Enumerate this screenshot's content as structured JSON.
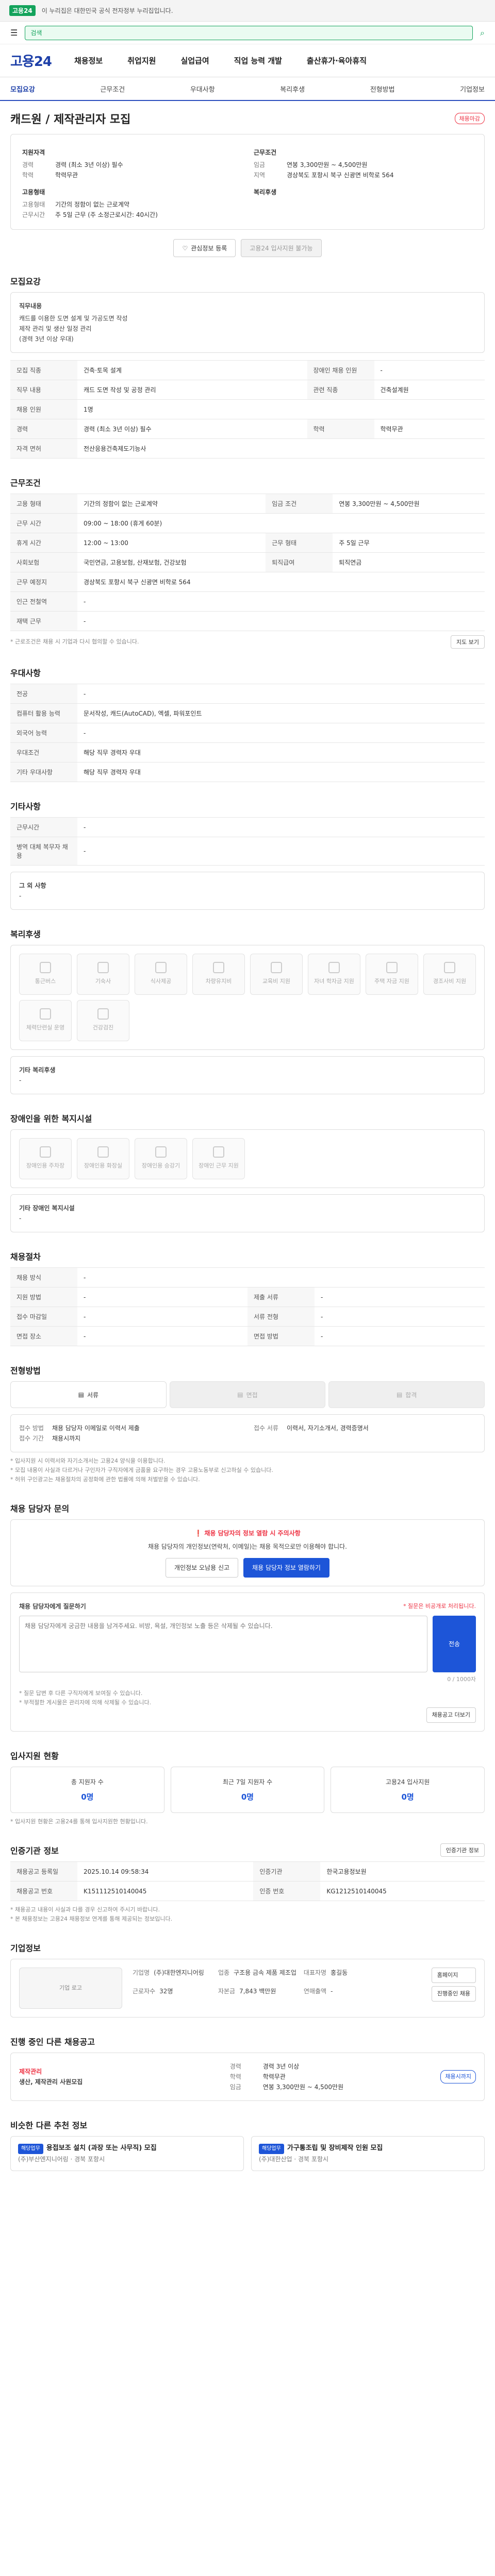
{
  "topbar": {
    "notice": "이 누리집은 대한민국 공식 전자정부 누리집입니다.",
    "logo": "고용24"
  },
  "subbar": {
    "search_placeholder": "검색",
    "search_button": "검색"
  },
  "header": {
    "brand": "고용24",
    "nav": [
      "채용정보",
      "취업지원",
      "실업급여",
      "직업 능력 개발",
      "출산휴가·육아휴직"
    ]
  },
  "tabs": [
    "모집요강",
    "근무조건",
    "우대사항",
    "복리후생",
    "전형방법",
    "기업정보"
  ],
  "job": {
    "title": "캐드원 / 제작관리자 모집",
    "badge": "채용마감",
    "left_head": "지원자격",
    "left_rows": [
      {
        "k": "경력",
        "v": "경력 (최소 3년 이상) 필수"
      },
      {
        "k": "학력",
        "v": "학력무관"
      }
    ],
    "left_head2": "고용형태",
    "left_rows2": [
      {
        "k": "고용형태",
        "v": "기간의 정함이 없는 근로계약"
      },
      {
        "k": "근무시간",
        "v": "주 5일 근무 (주 소정근로시간: 40시간)"
      }
    ],
    "right_head": "근무조건",
    "right_rows": [
      {
        "k": "임금",
        "v": "연봉 3,300만원 ~ 4,500만원"
      },
      {
        "k": "지역",
        "v": "경상북도 포항시 북구 신광면 비학로 564"
      }
    ],
    "right_head2": "복리후생",
    "btn_save": "관심정보 등록",
    "btn_apply": "고용24 입사지원 불가능"
  },
  "recruit": {
    "title": "모집요강",
    "summary_head": "직무내용",
    "summary_lines": [
      "캐드를 이용한 도면 설계 및 가공도면 작성",
      "제작 관리 및 생산 일정 관리",
      "(경력 3년 이상 우대)"
    ],
    "rows": [
      {
        "k": "모집 직종",
        "v": "건축·토목 설계",
        "k2": "장애인 채용 인원",
        "v2": "-"
      },
      {
        "k": "직무 내용",
        "v": "캐드 도면 작성 및 공정 관리",
        "k2": "관련 직종",
        "v2": "건축설계원"
      },
      {
        "k": "채용 인원",
        "v": "1명",
        "k2": "",
        "v2": ""
      },
      {
        "k": "경력",
        "v": "경력 (최소 3년 이상) 필수",
        "k2": "학력",
        "v2": "학력무관"
      },
      {
        "k": "자격 면허",
        "v": "전산응용건축제도기능사",
        "k2": "",
        "v2": ""
      }
    ]
  },
  "condition": {
    "title": "근무조건",
    "rows": [
      {
        "k": "고용 형태",
        "v": "기간의 정함이 없는 근로계약",
        "k2": "임금 조건",
        "v2": "연봉 3,300만원 ~ 4,500만원"
      },
      {
        "k": "근무 시간",
        "v": "09:00 ~ 18:00 (휴게 60분)",
        "k2": "",
        "v2": ""
      },
      {
        "k": "휴게 시간",
        "v": "12:00 ~ 13:00",
        "k2": "근무 형태",
        "v2": "주 5일 근무"
      },
      {
        "k": "사회보험",
        "v": "국민연금, 고용보험, 산재보험, 건강보험",
        "k2": "퇴직급여",
        "v2": "퇴직연금"
      },
      {
        "k": "근무 예정지",
        "v": "경상북도 포항시 북구 신광면 비학로 564",
        "k2": "",
        "v2": ""
      },
      {
        "k": "인근 전철역",
        "v": "-",
        "k2": "",
        "v2": ""
      },
      {
        "k": "재택 근무",
        "v": "-",
        "k2": "",
        "v2": ""
      }
    ],
    "note": "* 근로조건은 채용 시 기업과 다시 협의할 수 있습니다.",
    "map_button": "지도 보기"
  },
  "prefer": {
    "title": "우대사항",
    "rows": [
      {
        "k": "전공",
        "v": "-"
      },
      {
        "k": "컴퓨터 활용 능력",
        "v": "문서작성, 캐드(AutoCAD), 엑셀, 파워포인트"
      },
      {
        "k": "외국어 능력",
        "v": "-"
      },
      {
        "k": "우대조건",
        "v": "해당 직무 경력자 우대"
      },
      {
        "k": "기타 우대사항",
        "v": "해당 직무 경력자 우대"
      }
    ]
  },
  "other": {
    "title": "기타사항",
    "rows": [
      {
        "k": "근무시간",
        "v": "-"
      },
      {
        "k": "병역 대체 복무자 채용",
        "v": "-"
      }
    ],
    "extra_label": "그 외 사항",
    "extra_value": "-"
  },
  "welfare": {
    "title": "복리후생",
    "items": [
      "통근버스",
      "기숙사",
      "식사제공",
      "차량유지비",
      "교육비 지원",
      "자녀 학자금 지원",
      "주택 자금 지원",
      "경조사비 지원",
      "체력단련실 운영",
      "건강검진"
    ],
    "extra_label": "기타 복리후생",
    "extra_value": "-"
  },
  "disability": {
    "title": "장애인을 위한 복지시설",
    "items": [
      "장애인용 주차장",
      "장애인용 화장실",
      "장애인용 승강기",
      "장애인 근무 지원"
    ],
    "extra_label": "기타 장애인 복지시설",
    "extra_value": "-"
  },
  "recruitment": {
    "title": "채용절차",
    "rows": [
      {
        "k": "채용 방식",
        "v": "-",
        "k2": "",
        "v2": ""
      },
      {
        "k": "지원 방법",
        "v": "-",
        "k2": "제출 서류",
        "v2": "-"
      },
      {
        "k": "접수 마감일",
        "v": "-",
        "k2": "서류 전형",
        "v2": "-"
      },
      {
        "k": "면접 장소",
        "v": "-",
        "k2": "면접 방법",
        "v2": "-"
      }
    ]
  },
  "screening": {
    "title": "전형방법",
    "steps": [
      "서류",
      "면접",
      "합격"
    ],
    "apply_info": [
      {
        "k": "접수 방법",
        "v": "채용 담당자 이메일로 이력서 제출"
      },
      {
        "k": "접수 기간",
        "v": "채용시까지"
      }
    ],
    "contact_info": [
      {
        "k": "접수 서류",
        "v": "이력서, 자기소개서, 경력증명서"
      }
    ],
    "notes": [
      "* 입사지원 시 이력서와 자기소개서는 고용24 양식을 이용합니다.",
      "* 모집 내용이 사실과 다르거나 구인자가 구직자에게 금품을 요구하는 경우 고용노동부로 신고하실 수 있습니다.",
      "* 허위 구인광고는 채용절차의 공정화에 관한 법률에 의해 처벌받을 수 있습니다."
    ]
  },
  "qna": {
    "title": "채용 담당자 문의",
    "warn": "채용 담당자의 정보 열람 시 주의사항",
    "desc": "채용 담당자의 개인정보(연락처, 이메일)는 채용 목적으로만 이용해야 합니다.",
    "btn_report": "개인정보 오남용 신고",
    "btn_view": "채용 담당자 정보 열람하기",
    "form_title": "채용 담당자에게 질문하기",
    "form_note": "* 질문은 비공개로 처리됩니다.",
    "placeholder": "채용 담당자에게 궁금한 내용을 남겨주세요. 비방, 욕설, 개인정보 노출 등은 삭제될 수 있습니다.",
    "counter": "0 / 1000자",
    "submit": "전송",
    "tips": [
      "* 질문 답변 후 다른 구직자에게 보여질 수 있습니다.",
      "* 부적절한 게시물은 관리자에 의해 삭제될 수 있습니다."
    ],
    "more": "채용공고 더보기"
  },
  "applicants": {
    "title": "입사지원 현황",
    "stats": [
      {
        "label": "총 지원자 수",
        "value": "0명"
      },
      {
        "label": "최근 7일 지원자 수",
        "value": "0명"
      },
      {
        "label": "고용24 입사지원",
        "value": "0명"
      }
    ],
    "note": "* 입사지원 현황은 고용24를 통해 입사지원한 현황입니다."
  },
  "source": {
    "title": "인증기관 정보",
    "btn": "인증기관 정보",
    "rows": [
      {
        "k": "채용공고 등록일",
        "v": "2025.10.14 09:58:34",
        "k2": "인증기관",
        "v2": "한국고용정보원"
      },
      {
        "k": "채용공고 번호",
        "v": "K151112510140045",
        "k2": "인증 번호",
        "v2": "KG1212510140045"
      }
    ],
    "notes": [
      "* 채용공고 내용이 사실과 다를 경우 신고하여 주시기 바랍니다.",
      "* 본 채용정보는 고용24 채용정보 연계를 통해 제공되는 정보입니다."
    ]
  },
  "company": {
    "title": "기업정보",
    "logo_alt": "기업 로고",
    "name": "(주)대한엔지니어링",
    "rows": [
      {
        "k": "기업명",
        "v": "(주)대한엔지니어링"
      },
      {
        "k": "업종",
        "v": "구조용 금속 제품 제조업"
      },
      {
        "k": "대표자명",
        "v": "홍길동"
      },
      {
        "k": "근로자수",
        "v": "32명"
      },
      {
        "k": "자본금",
        "v": "7,843 백만원"
      },
      {
        "k": "연매출액",
        "v": "-"
      }
    ],
    "btn_home": "홈페이지",
    "btn_jobs": "진행중인 채용"
  },
  "ongoing": {
    "title": "진행 중인 다른 채용공고",
    "job_title": "제작관리",
    "job_sub": "생산, 제작관리 사원모집",
    "info": [
      {
        "k": "경력",
        "v": "경력 3년 이상"
      },
      {
        "k": "학력",
        "v": "학력무관"
      },
      {
        "k": "임금",
        "v": "연봉 3,300만원 ~ 4,500만원"
      }
    ],
    "deadline": "채용시까지"
  },
  "similar": {
    "title": "비슷한 다른 추천 정보",
    "items": [
      {
        "tag": "해당업무",
        "title": "용접보조 설치 (과장 또는 사무직) 모집",
        "sub": "(주)부산엔지니어링 · 경북 포항시"
      },
      {
        "tag": "해당업무",
        "title": "가구통조립 및 장비제작 인원 모집",
        "sub": "(주)대한산업 · 경북 포항시"
      }
    ]
  }
}
